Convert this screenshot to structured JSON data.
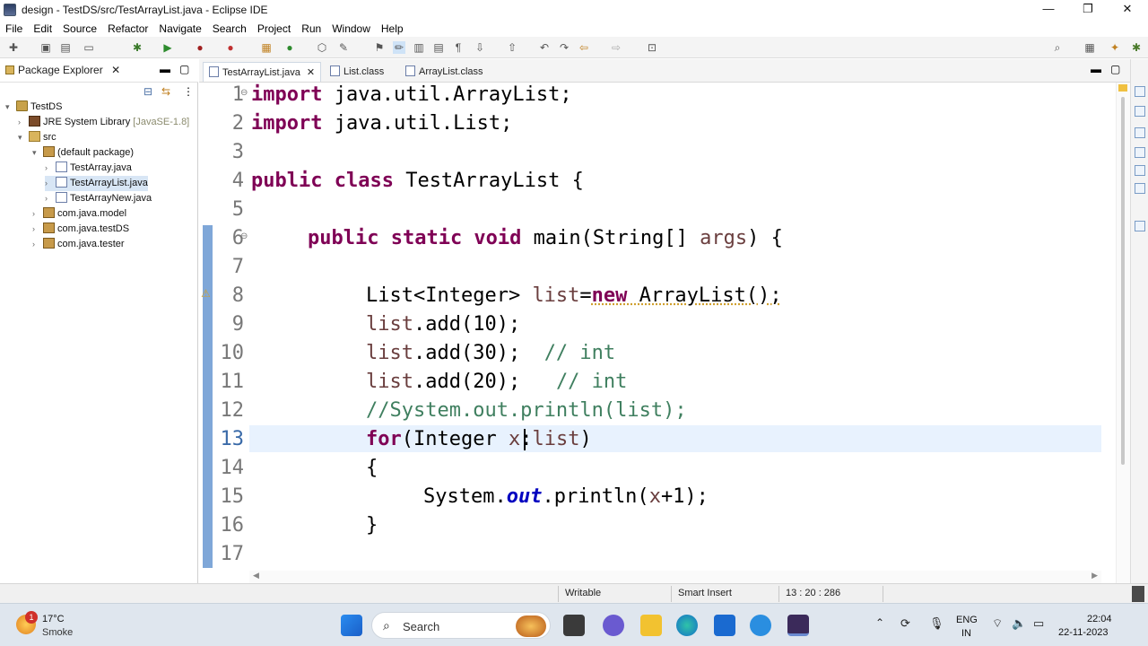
{
  "window": {
    "title": "design - TestDS/src/TestArrayList.java - Eclipse IDE",
    "minimize": "—",
    "maximize": "❐",
    "close": "✕"
  },
  "menu": [
    "File",
    "Edit",
    "Source",
    "Refactor",
    "Navigate",
    "Search",
    "Project",
    "Run",
    "Window",
    "Help"
  ],
  "package_explorer": {
    "tab_label": "Package Explorer",
    "tree": [
      {
        "label": "TestDS",
        "twisty": "▾",
        "icon": "project-icon"
      },
      {
        "label": "JRE System Library",
        "suffix": "[JavaSE-1.8]",
        "twisty": "›",
        "icon": "library-icon"
      },
      {
        "label": "src",
        "twisty": "▾",
        "icon": "source-folder-icon"
      },
      {
        "label": "(default package)",
        "twisty": "▾",
        "icon": "package-icon"
      },
      {
        "label": "TestArray.java",
        "twisty": "›",
        "icon": "java-file-icon"
      },
      {
        "label": "TestArrayList.java",
        "twisty": "›",
        "icon": "java-file-icon",
        "selected": true
      },
      {
        "label": "TestArrayNew.java",
        "twisty": "›",
        "icon": "java-file-icon"
      },
      {
        "label": "com.java.model",
        "twisty": "›",
        "icon": "package-icon"
      },
      {
        "label": "com.java.testDS",
        "twisty": "›",
        "icon": "package-icon"
      },
      {
        "label": "com.java.tester",
        "twisty": "›",
        "icon": "package-icon"
      }
    ]
  },
  "editor": {
    "tabs": [
      {
        "label": "TestArrayList.java",
        "active": true
      },
      {
        "label": "List.class",
        "active": false
      },
      {
        "label": "ArrayList.class",
        "active": false
      }
    ],
    "line_numbers": [
      "1",
      "2",
      "3",
      "4",
      "5",
      "6",
      "7",
      "8",
      "9",
      "10",
      "11",
      "12",
      "13",
      "14",
      "15",
      "16",
      "17"
    ],
    "fold_markers": {
      "line1": "⊖",
      "line6": "⊖"
    },
    "code": {
      "l1_kw": "import",
      "l1_rest": " java.util.ArrayList;",
      "l2_kw": "import",
      "l2_rest": " java.util.List;",
      "l4_kw": "public class",
      "l4_rest": " TestArrayList {",
      "l6_kw": "public static void",
      "l6_rest": " main(String[] ",
      "l6_var": "args",
      "l6_end": ") {",
      "l8_a": "List<Integer> ",
      "l8_var": "list",
      "l8_eq": "=",
      "l8_kw": "new",
      "l8_rest": " ArrayList();",
      "l9_var": "list",
      "l9_rest": ".add(10);",
      "l10_var": "list",
      "l10_rest": ".add(30);  ",
      "l10_cm": "// int",
      "l11_var": "list",
      "l11_rest": ".add(20);   ",
      "l11_cm": "// int",
      "l12_cm": "//System.out.println(list);",
      "l13_kw": "for",
      "l13_a": "(Integer ",
      "l13_var": "x",
      "l13_b": ":",
      "l13_var2": "list",
      "l13_c": ")",
      "l14": "{",
      "l15_a": "System.",
      "l15_fld": "out",
      "l15_b": ".println(",
      "l15_var": "x",
      "l15_c": "+1);",
      "l16": "}"
    }
  },
  "status": {
    "writable": "Writable",
    "insert_mode": "Smart Insert",
    "position": "13 : 20 : 286"
  },
  "taskbar": {
    "weather_temp": "17°C",
    "weather_desc": "Smoke",
    "notification_count": "1",
    "search_label": "Search",
    "lang_top": "ENG",
    "lang_bottom": "IN",
    "time": "22:04",
    "date": "22-11-2023"
  },
  "colors": {
    "keyword": "#7f0055",
    "comment": "#3f7f5f",
    "field": "#0000c0",
    "variable": "#6a3e3e",
    "current_line": "#e8f2fe"
  }
}
